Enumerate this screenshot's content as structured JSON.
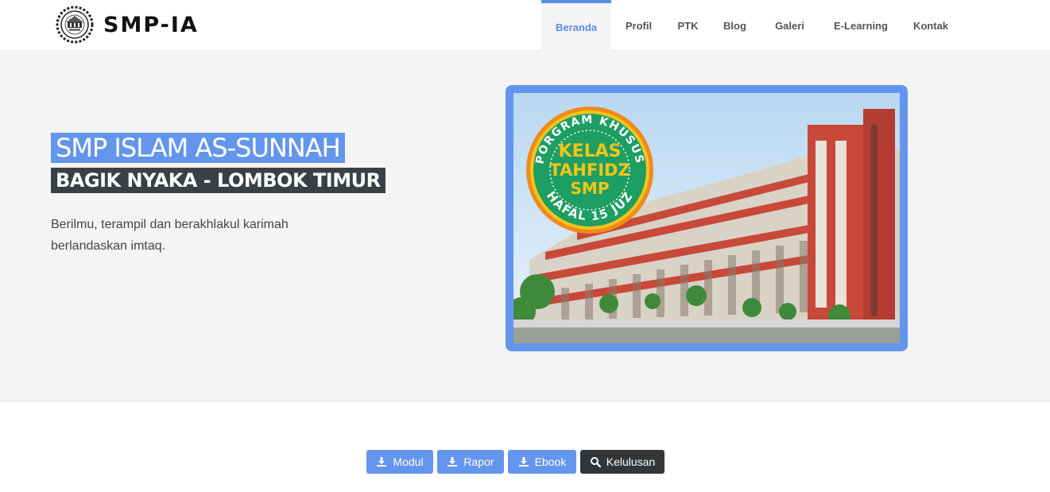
{
  "brand": {
    "name": "SMP-IA",
    "logo_icon": "school-emblem-icon"
  },
  "nav": {
    "items": [
      {
        "label": "Beranda",
        "active": true
      },
      {
        "label": "Profil",
        "active": false
      },
      {
        "label": "PTK",
        "active": false
      },
      {
        "label": "Blog",
        "active": false
      },
      {
        "label": "Galeri",
        "active": false
      },
      {
        "label": "E-Learning",
        "active": false
      },
      {
        "label": "Kontak",
        "active": false
      }
    ]
  },
  "hero": {
    "title": "SMP ISLAM AS-SUNNAH",
    "subtitle": "BAGIK NYAKA - LOMBOK TIMUR",
    "tagline": "Berilmu, terampil dan berakhlakul karimah berlandaskan imtaq.",
    "badge": {
      "top_text": "PORGRAM KHUSUS",
      "line1": "KELAS",
      "line2": "TAHFIDZ",
      "line3": "SMP",
      "bottom_text": "HAFAL 15 JUZ"
    }
  },
  "actions": [
    {
      "label": "Modul",
      "icon": "download-icon",
      "style": "primary"
    },
    {
      "label": "Rapor",
      "icon": "download-icon",
      "style": "primary"
    },
    {
      "label": "Ebook",
      "icon": "download-icon",
      "style": "primary"
    },
    {
      "label": "Kelulusan",
      "icon": "search-icon",
      "style": "dark"
    }
  ],
  "colors": {
    "accent": "#6495ed",
    "dark": "#333638",
    "subtitle_bg": "#3a4146",
    "hero_bg": "#f4f4f4",
    "badge_green": "#1e9e63",
    "badge_orange": "#f08a1c",
    "badge_yellow": "#f5c518"
  }
}
